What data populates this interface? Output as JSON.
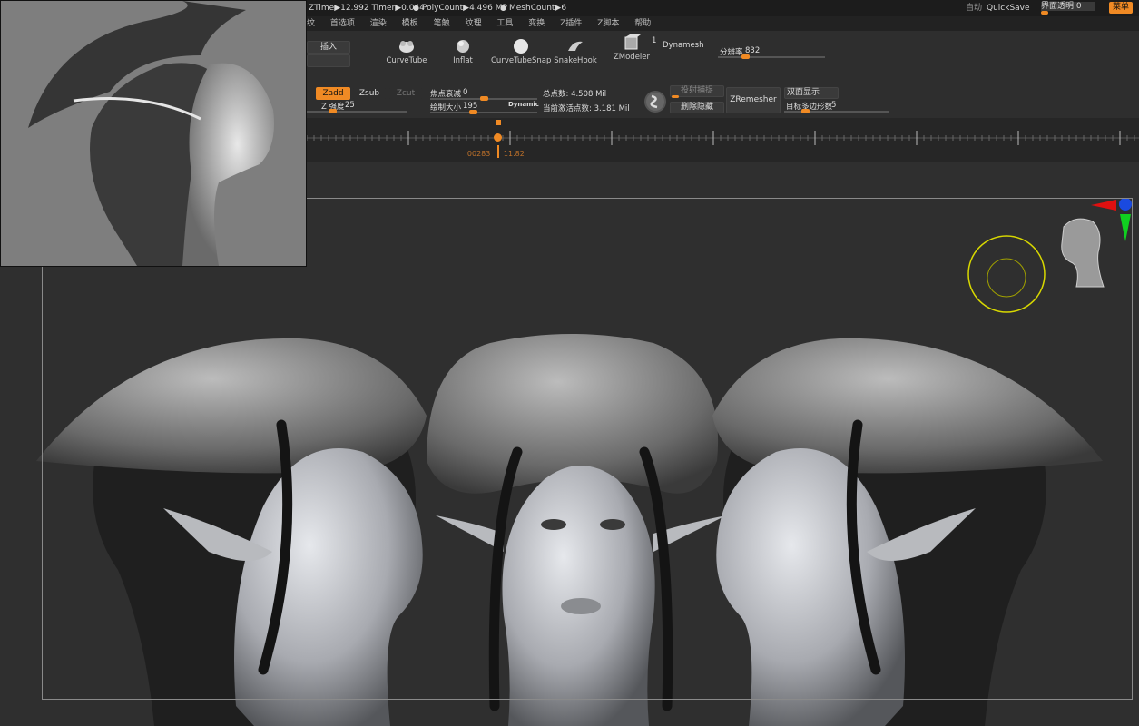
{
  "status": {
    "ztime": "ZTime▶12.992 Timer▶0.044",
    "polycount": "PolyCount▶4.496 MP",
    "meshcount": "MeshCount▶6",
    "auto_label": "自动",
    "quicksave": "QuickSave",
    "transparency_label": "界面透明 0",
    "menu_button": "菜单"
  },
  "menus": [
    "纹",
    "首选项",
    "渲染",
    "模板",
    "笔触",
    "纹理",
    "工具",
    "变换",
    "Z插件",
    "Z脚本",
    "帮助"
  ],
  "brushes": [
    {
      "label": "CurveTube",
      "icon": "curvetube-icon"
    },
    {
      "label": "Inflat",
      "icon": "inflat-icon"
    },
    {
      "label": "CurveTubeSnap",
      "icon": "curvetubesnap-icon"
    },
    {
      "label": "SnakeHook",
      "icon": "snakehook-icon"
    },
    {
      "label": "ZModeler",
      "icon": "zmodeler-icon"
    }
  ],
  "zmodeler_count": "1",
  "dynamesh": "Dynamesh",
  "resolution": {
    "label": "分辨率",
    "value": "832",
    "fraction": 0.25
  },
  "insert_label": "插入",
  "zadd": "Zadd",
  "zsub": "Zsub",
  "zcut": "Zcut",
  "z_intensity": {
    "label": "Z 强度",
    "value": "25",
    "fraction": 0.25
  },
  "focal_shift": {
    "label": "焦点衰减",
    "value": "0",
    "fraction": 0.5
  },
  "draw_size": {
    "label": "绘制大小",
    "value": "195",
    "fraction": 0.4
  },
  "dynamic": "Dynamic",
  "total_points": "总点数: 4.508 Mil",
  "active_points": "当前激活点数: 3.181 Mil",
  "projection": "投射捕捉",
  "delete_hidden": "删除隐藏",
  "zremesher": "ZRemesher",
  "double_side": "双面显示",
  "target_polys": {
    "label": "目标多边形数",
    "value": "5",
    "fraction": 0.2
  },
  "timeline": {
    "frame": "00283",
    "time": "11.82",
    "position_fraction": 0.23
  },
  "colors": {
    "accent": "#f08a24",
    "background": "#2f2f2f",
    "panel": "#2e2e2e"
  }
}
